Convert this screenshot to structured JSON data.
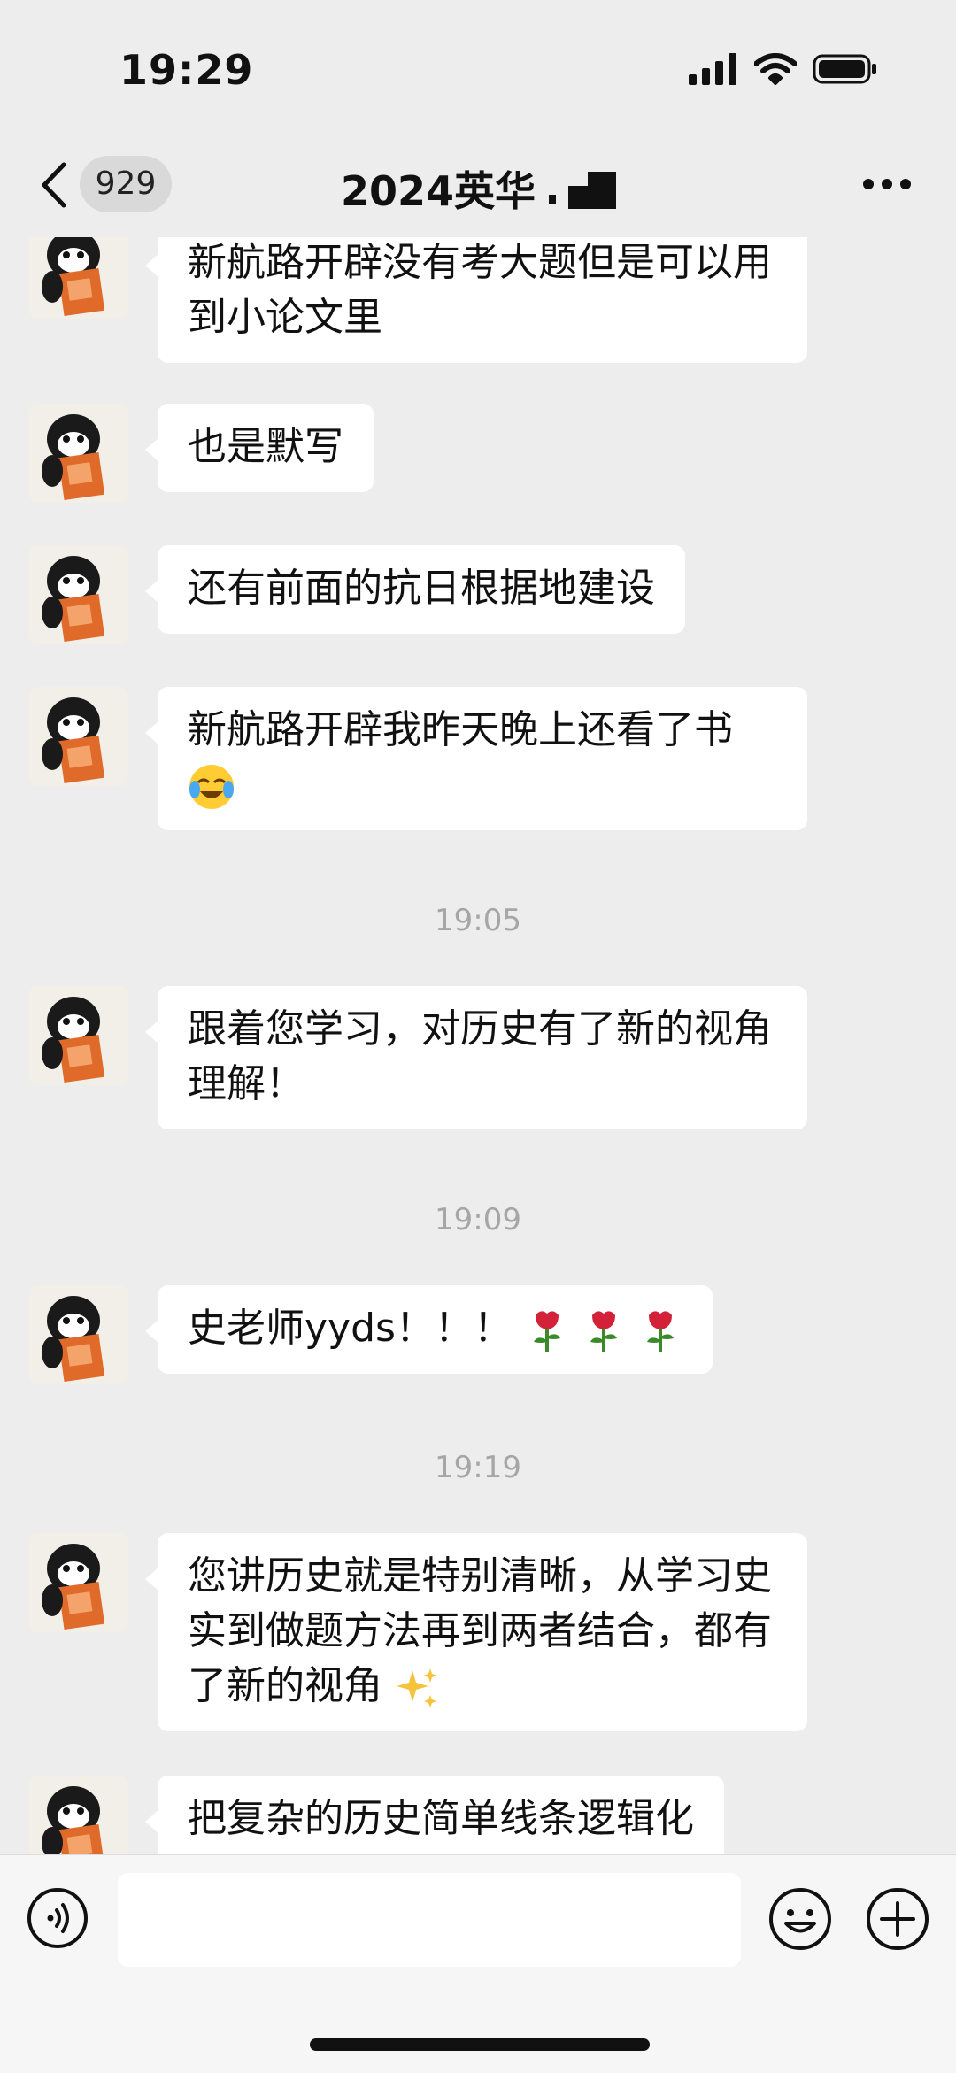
{
  "status_bar": {
    "time": "19:29"
  },
  "nav": {
    "unread_count": "929",
    "title": "2024英华"
  },
  "messages": [
    {
      "type": "text",
      "text": "新航路开辟没有考大题但是可以用到小论文里"
    },
    {
      "type": "text",
      "text": "也是默写"
    },
    {
      "type": "text",
      "text": "还有前面的抗日根据地建设"
    },
    {
      "type": "text",
      "text": "新航路开辟我昨天晚上还看了书",
      "emoji": "crying-laughing-face"
    },
    {
      "type": "time",
      "text": "19:05"
    },
    {
      "type": "text",
      "text": "跟着您学习，对历史有了新的视角理解！"
    },
    {
      "type": "time",
      "text": "19:09"
    },
    {
      "type": "text",
      "text": "史老师yyds！！！",
      "emoji": "rose x3"
    },
    {
      "type": "time",
      "text": "19:19"
    },
    {
      "type": "text",
      "text": "您讲历史就是特别清晰，从学习史实到做题方法再到两者结合，都有了新的视角",
      "emoji": "sparkles"
    },
    {
      "type": "text",
      "text": "把复杂的历史简单线条逻辑化"
    }
  ],
  "input": {
    "placeholder": ""
  },
  "colors": {
    "background": "#ededed",
    "bubble": "#ffffff",
    "timestamp": "#a6a6a6",
    "badge": "#d9d9d9"
  },
  "icons": [
    "chevron-left-icon",
    "more-icon",
    "voice-icon",
    "emoji-icon",
    "plus-icon",
    "signal-icon",
    "wifi-icon",
    "battery-icon",
    "penguin-avatar"
  ]
}
